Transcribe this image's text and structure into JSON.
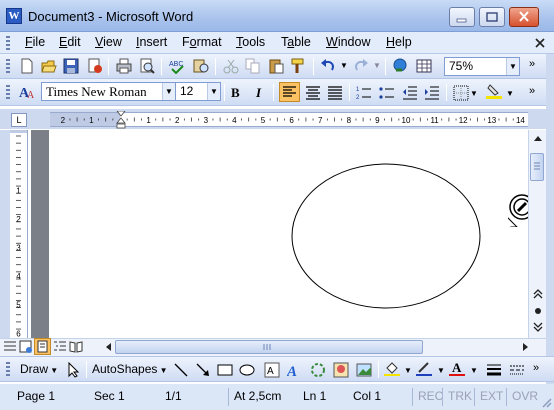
{
  "window": {
    "title": "Document3 - Microsoft Word",
    "app_icon_letter": "W"
  },
  "menu": [
    "File",
    "Edit",
    "View",
    "Insert",
    "Format",
    "Tools",
    "Table",
    "Window",
    "Help"
  ],
  "menu_mnemonics": [
    "F",
    "E",
    "V",
    "I",
    "o",
    "T",
    "a",
    "W",
    "H"
  ],
  "standard_toolbar": {
    "icons": [
      "new-document-icon",
      "open-folder-icon",
      "save-icon",
      "permission-icon",
      "print-icon",
      "print-preview-icon",
      "spelling-icon",
      "research-icon",
      "cut-icon",
      "copy-icon",
      "paste-icon",
      "format-painter-icon",
      "undo-icon",
      "redo-icon",
      "hyperlink-icon",
      "tables-borders-icon"
    ],
    "zoom": "75%"
  },
  "formatting_toolbar": {
    "style_icon": "styles-icon",
    "font": "Times New Roman",
    "size": "12",
    "bold": "B",
    "italic": "I",
    "alignment_active": "align-left",
    "highlight_color": "#f5e400",
    "font_color": "#e01010"
  },
  "ruler": {
    "corner_label": "L",
    "labels": [
      "2",
      "1",
      "1",
      "2",
      "3",
      "4",
      "5",
      "6",
      "7",
      "8",
      "9",
      "10",
      "11",
      "12",
      "13",
      "14"
    ]
  },
  "canvas": {
    "shape": "ellipse",
    "stroke": "#000000"
  },
  "drawing_toolbar": {
    "draw": "Draw",
    "autoshapes": "AutoShapes",
    "fill_color": "#f5e400",
    "line_color": "#1f3fbf",
    "font_color": "#e01010",
    "font_color_letter": "A"
  },
  "status": {
    "page": "Page 1",
    "section": "Sec 1",
    "page_count": "1/1",
    "position": "At 2,5cm",
    "line": "Ln 1",
    "column": "Col 1",
    "rec": "REC",
    "trk": "TRK",
    "ext": "EXT",
    "ovr": "OVR"
  }
}
